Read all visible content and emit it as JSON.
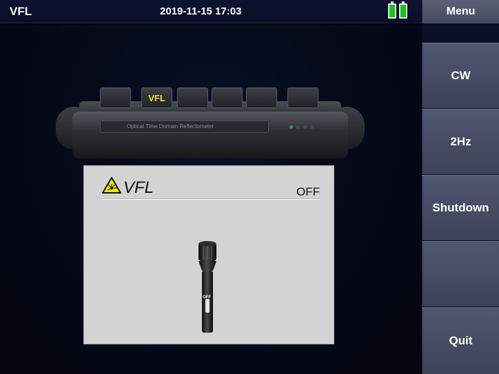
{
  "status_bar": {
    "title": "VFL",
    "datetime": "2019-11-15 17:03",
    "battery_icons": [
      "battery-full-icon",
      "battery-full-icon"
    ],
    "battery_color": "#11c711"
  },
  "device": {
    "key_label": "VFL",
    "model_label": "Optical Time Domain Reflectometer"
  },
  "vfl_panel": {
    "title": "VFL",
    "state": "OFF",
    "warning_icon": "laser-warning-icon",
    "flashlight_state_label": "OFF"
  },
  "menu": {
    "header": "Menu",
    "buttons": [
      {
        "label": "CW"
      },
      {
        "label": "2Hz"
      },
      {
        "label": "Shutdown"
      },
      {
        "label": ""
      },
      {
        "label": "Quit"
      }
    ]
  },
  "colors": {
    "menu_button": "#4a4f68",
    "background": "#050918",
    "key_accent": "#f2e23a"
  }
}
